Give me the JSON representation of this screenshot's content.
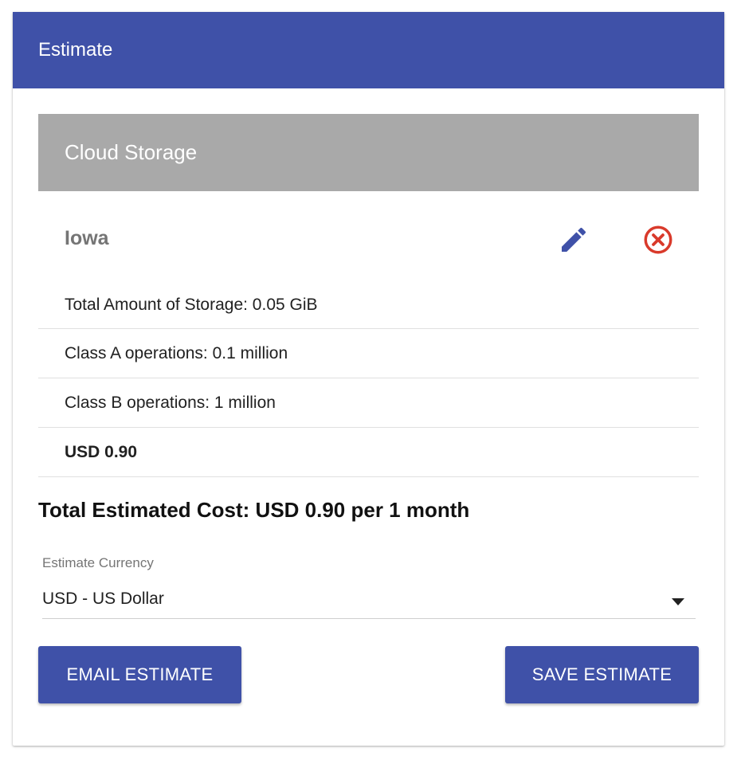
{
  "header": {
    "title": "Estimate"
  },
  "service": {
    "name": "Cloud Storage"
  },
  "region": {
    "name": "Iowa",
    "edit_icon": "pencil-icon",
    "remove_icon": "close-circle-icon"
  },
  "line_items": [
    "Total Amount of Storage: 0.05 GiB",
    "Class A operations: 0.1 million",
    "Class B operations: 1 million"
  ],
  "subtotal": "USD 0.90",
  "total_cost": "Total Estimated Cost: USD 0.90 per 1 month",
  "currency": {
    "label": "Estimate Currency",
    "selected": "USD - US Dollar"
  },
  "buttons": {
    "email": "EMAIL ESTIMATE",
    "save": "SAVE ESTIMATE"
  },
  "colors": {
    "primary": "#3f51a8",
    "service_bar": "#a9a9a9",
    "remove": "#d93a2b"
  }
}
